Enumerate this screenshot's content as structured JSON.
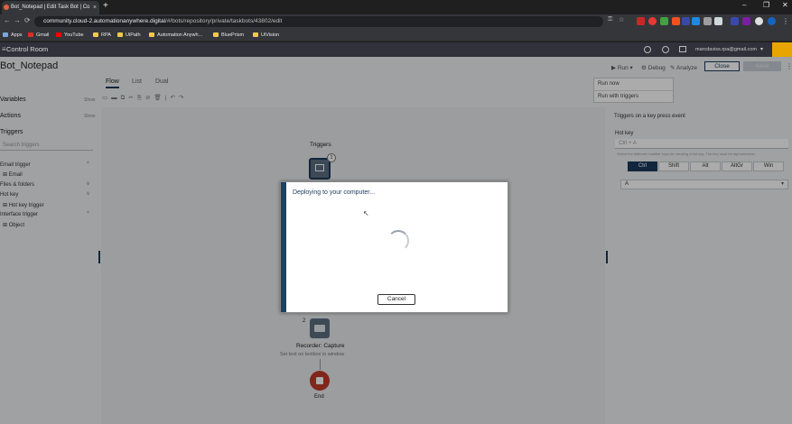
{
  "browser": {
    "tab_title": "Bot_Notepad | Edit Task Bot | Co",
    "tab_close": "×",
    "new_tab": "+",
    "window_controls": [
      "–",
      "❐",
      "✕"
    ],
    "nav": {
      "back": "←",
      "forward": "→",
      "reload": "⟳"
    },
    "url_host": "community.cloud-2.automationanywhere.digital",
    "url_path": "/#/bots/repository/private/taskbots/43802/edit",
    "bookmarks": [
      "Apps",
      "Gmail",
      "YouTube",
      "RPA",
      "UiPath",
      "Automation Anywh...",
      "BluePrism",
      "UiVision"
    ]
  },
  "header": {
    "app_title": "Control Room",
    "user_email": "marcdaviss.rpa@gmail.com"
  },
  "editor": {
    "bot_name": "Bot_Notepad",
    "tabs": [
      "Flow",
      "List",
      "Dual"
    ],
    "toolbar": {
      "run": "Run",
      "debug": "Debug",
      "analyze": "Analyze",
      "close": "Close",
      "save": "Save"
    },
    "run_menu": [
      "Run now",
      "Run with triggers"
    ]
  },
  "left_panel": {
    "variables": "Variables",
    "actions": "Actions",
    "show": "Show",
    "triggers": "Triggers",
    "search_placeholder": "Search triggers",
    "groups": [
      {
        "label": "Email trigger",
        "child": "Email"
      },
      {
        "label": "Files & folders",
        "child": ""
      },
      {
        "label": "Hot key",
        "child": "Hot key trigger"
      },
      {
        "label": "Interface trigger",
        "child": "Object"
      }
    ]
  },
  "canvas": {
    "triggers_label": "Triggers",
    "trigger_count": "1",
    "step_number": "2",
    "step_title": "Recorder: Capture",
    "step_desc": "Set text on textbox in window",
    "end_label": "End"
  },
  "right_panel": {
    "description": "Triggers on a key press event",
    "hotkey_label": "Hot key",
    "hotkey_value": "Ctrl + A",
    "hint": "Select the different modifier keys for creating a hot key. The key must be alphanumeric",
    "modifiers": [
      "Ctrl",
      "Shift",
      "Alt",
      "AltGr",
      "Win"
    ],
    "key_select": "A"
  },
  "dialog": {
    "message": "Deploying to your computer...",
    "cancel": "Cancel"
  }
}
